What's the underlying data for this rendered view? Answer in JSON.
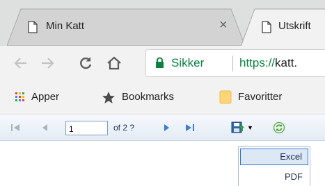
{
  "tabs": [
    {
      "title": "Min Katt",
      "close": "×",
      "icon": "document-icon"
    },
    {
      "title": "Utskrift",
      "icon": "document-icon"
    }
  ],
  "toolbar": {
    "back_icon": "arrow-left-icon",
    "forward_icon": "arrow-right-icon",
    "reload_icon": "reload-icon",
    "home_icon": "home-icon",
    "secure_label": "Sikker",
    "url_scheme": "https://",
    "url_host": "katt."
  },
  "bookmarks": [
    {
      "label": "Apper",
      "icon": "apps-grid-icon"
    },
    {
      "label": "Bookmarks",
      "icon": "star-icon"
    },
    {
      "label": "Favoritter",
      "icon": "folder-icon"
    }
  ],
  "report_viewer": {
    "page_value": "1",
    "page_of": "of 2 ?",
    "export_icon": "save-disk-icon",
    "refresh_icon": "refresh-icon",
    "export_options": [
      "Excel",
      "PDF"
    ],
    "highlighted_option": "Excel"
  },
  "colors": {
    "secure_green": "#0b8043",
    "nav_blue": "#3a7bd5",
    "dropdown_border": "#2f73c9"
  }
}
